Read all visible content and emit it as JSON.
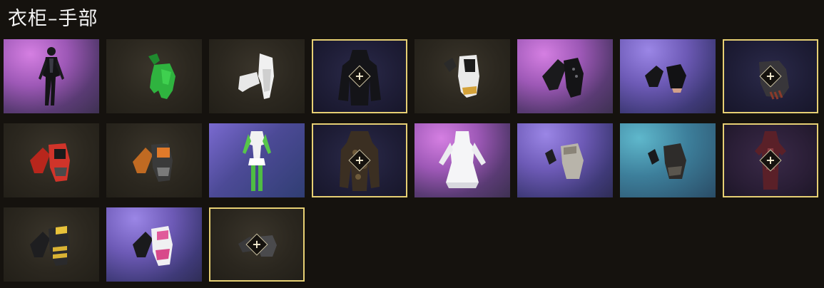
{
  "header": {
    "title": "衣柜–手部"
  },
  "wardrobe": {
    "items": [
      {
        "slot": "black-bodysuit-icon",
        "bg": "pink",
        "selected": false
      },
      {
        "slot": "green-gloves-icon",
        "bg": "dark",
        "selected": false
      },
      {
        "slot": "white-gloves-icon",
        "bg": "dark",
        "selected": false
      },
      {
        "slot": "black-hooded-suit-icon",
        "bg": "navy",
        "selected": true
      },
      {
        "slot": "white-black-gloves-icon",
        "bg": "dark",
        "selected": false
      },
      {
        "slot": "black-studded-gloves-icon",
        "bg": "pink",
        "selected": false
      },
      {
        "slot": "black-fingerless-gloves-icon",
        "bg": "purple",
        "selected": false
      },
      {
        "slot": "black-glove-icon",
        "bg": "navy",
        "selected": true
      },
      {
        "slot": "red-racing-gloves-icon",
        "bg": "dark",
        "selected": false
      },
      {
        "slot": "orange-racing-gloves-icon",
        "bg": "dark",
        "selected": false
      },
      {
        "slot": "green-white-outfit-icon",
        "bg": "violet",
        "selected": false
      },
      {
        "slot": "camo-suit-icon",
        "bg": "navy",
        "selected": true
      },
      {
        "slot": "white-dress-icon",
        "bg": "pink",
        "selected": false
      },
      {
        "slot": "grey-fingerless-gloves-icon",
        "bg": "purple",
        "selected": false
      },
      {
        "slot": "dark-fingerless-gloves-icon",
        "bg": "cyan",
        "selected": false
      },
      {
        "slot": "red-ornate-suit-icon",
        "bg": "plum",
        "selected": true
      },
      {
        "slot": "yellow-racing-gloves-icon",
        "bg": "dark",
        "selected": false
      },
      {
        "slot": "pink-racing-gloves-icon",
        "bg": "purple",
        "selected": false
      },
      {
        "slot": "grey-armor-glove-icon",
        "bg": "dark",
        "selected": true
      }
    ],
    "add_symbol": "+"
  }
}
